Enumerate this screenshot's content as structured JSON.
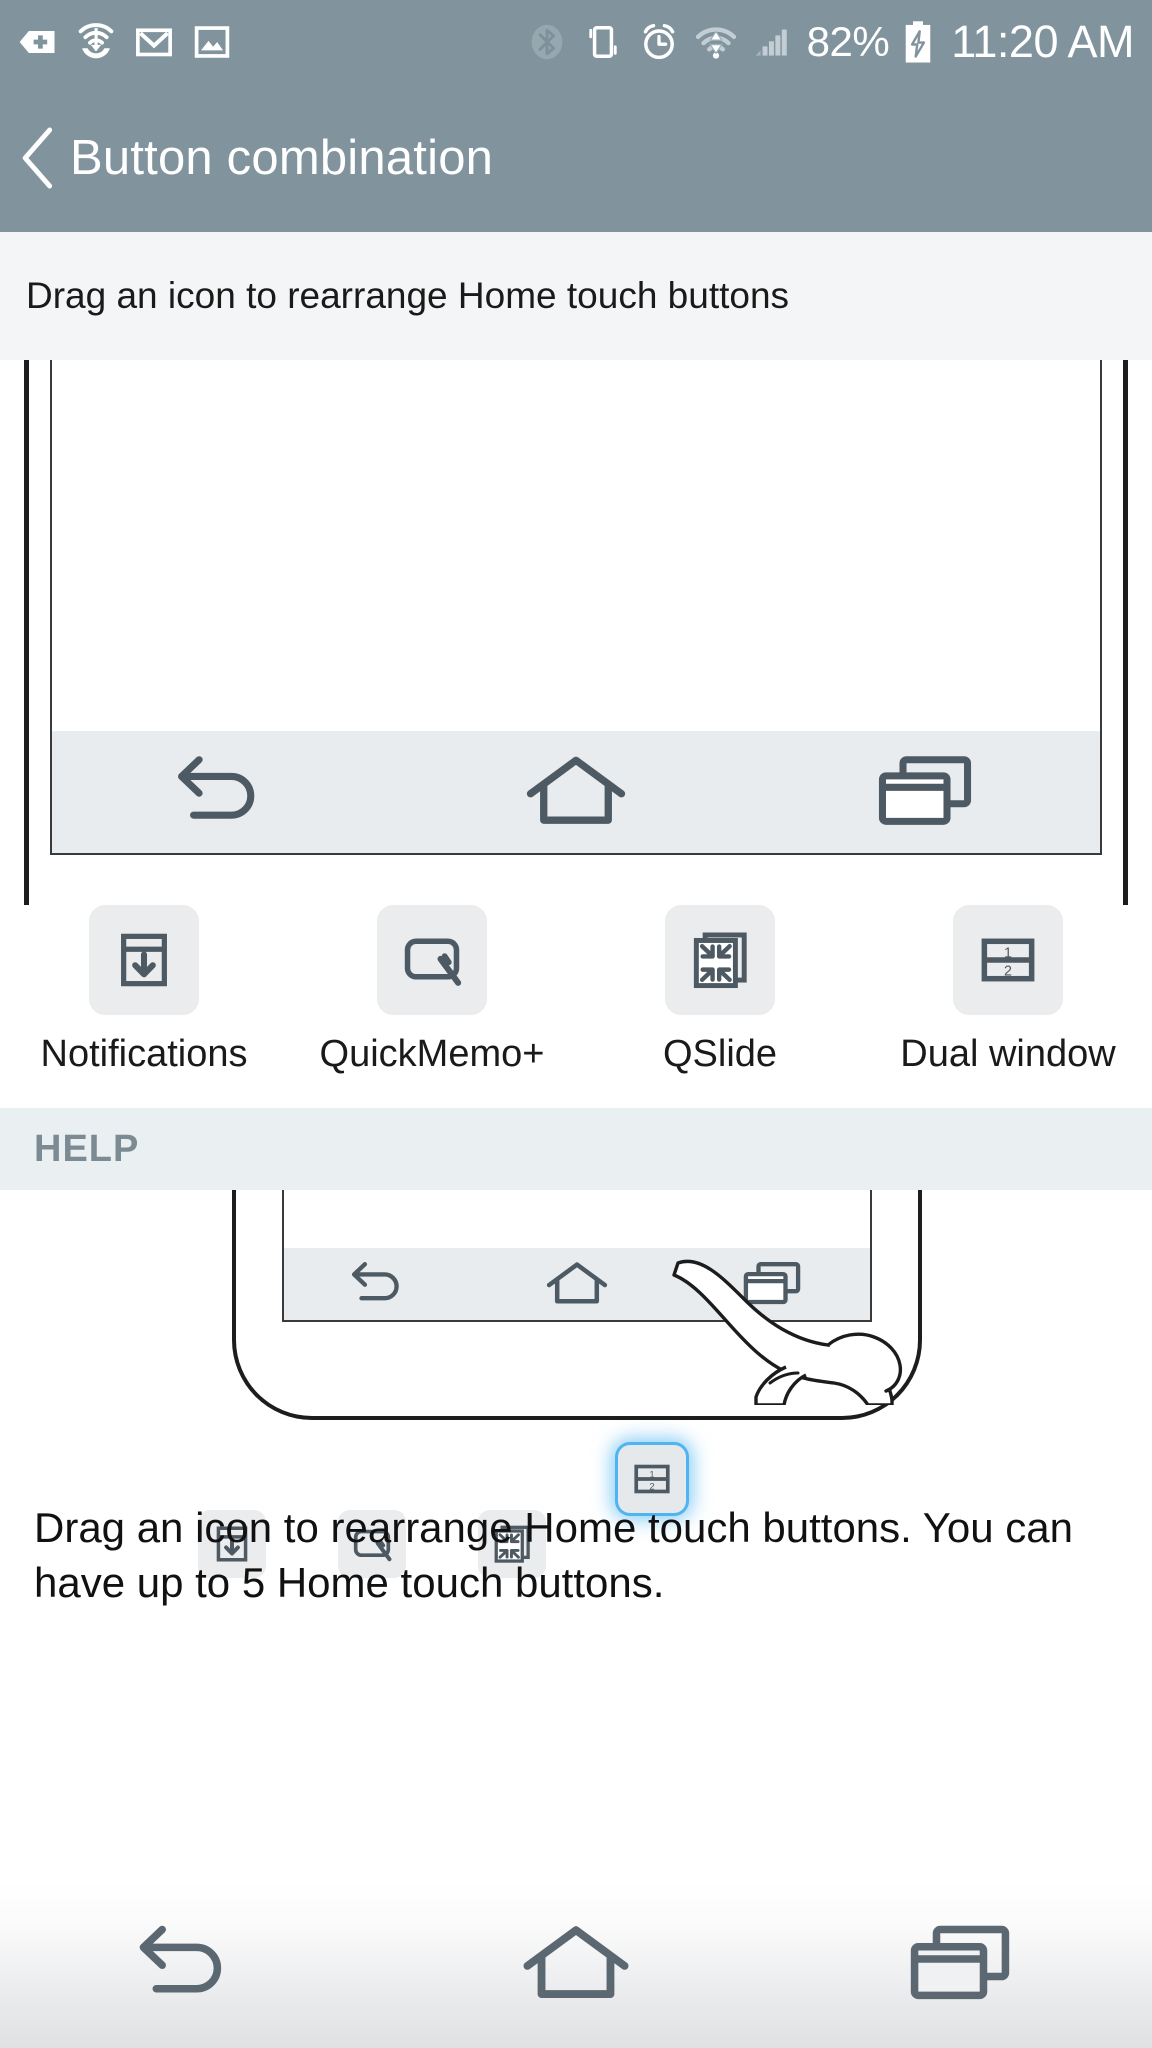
{
  "status_bar": {
    "left_icons": [
      {
        "name": "app-update-plus-icon"
      },
      {
        "name": "download-manager-icon"
      },
      {
        "name": "gmail-icon"
      },
      {
        "name": "gallery-image-icon"
      }
    ],
    "right_icons": [
      {
        "name": "bluetooth-off-icon"
      },
      {
        "name": "vibrate-mode-icon"
      },
      {
        "name": "alarm-clock-icon"
      },
      {
        "name": "wifi-icon"
      },
      {
        "name": "cellular-signal-icon"
      }
    ],
    "battery_percent": "82%",
    "battery_state_icon": "battery-charging-icon",
    "time": "11:20 AM"
  },
  "action_bar": {
    "back_icon": "chevron-left-icon",
    "title": "Button combination"
  },
  "instruction": {
    "text": "Drag an icon to rearrange Home touch buttons"
  },
  "preview": {
    "navbar_buttons": [
      {
        "name": "back-button-icon",
        "label": "Back"
      },
      {
        "name": "home-button-icon",
        "label": "Home"
      },
      {
        "name": "recent-apps-button-icon",
        "label": "Recent apps"
      }
    ]
  },
  "tray": {
    "items": [
      {
        "icon": "notifications-icon",
        "label": "Notifications"
      },
      {
        "icon": "quickmemo-plus-icon",
        "label": "QuickMemo+"
      },
      {
        "icon": "qslide-icon",
        "label": "QSlide"
      },
      {
        "icon": "dual-window-icon",
        "label": "Dual window",
        "dual_window_numbers": [
          "1",
          "2"
        ]
      }
    ]
  },
  "help": {
    "header": "HELP",
    "illustration": {
      "navbar_buttons": [
        "back-button-icon",
        "home-button-icon",
        "recent-apps-button-icon"
      ],
      "tiles": [
        {
          "icon": "notifications-icon",
          "highlighted": false
        },
        {
          "icon": "quickmemo-plus-icon",
          "highlighted": false
        },
        {
          "icon": "qslide-icon",
          "highlighted": false
        },
        {
          "icon": "dual-window-icon",
          "highlighted": true
        }
      ],
      "pointer": "hand-pointing-icon"
    },
    "text": "Drag an icon to rearrange Home touch buttons. You can have up to 5 Home touch buttons."
  },
  "system_nav": {
    "buttons": [
      {
        "name": "back-button-icon",
        "label": "Back"
      },
      {
        "name": "home-button-icon",
        "label": "Home"
      },
      {
        "name": "recent-apps-button-icon",
        "label": "Recent apps"
      }
    ]
  },
  "colors": {
    "action_bar_bg": "#81949e",
    "instruction_bg": "#f4f5f6",
    "help_header_bg": "#eaeff1",
    "icon_gray": "#4e5a63",
    "tile_bg": "#eaecee",
    "highlight_blue": "#4fb4ef"
  }
}
